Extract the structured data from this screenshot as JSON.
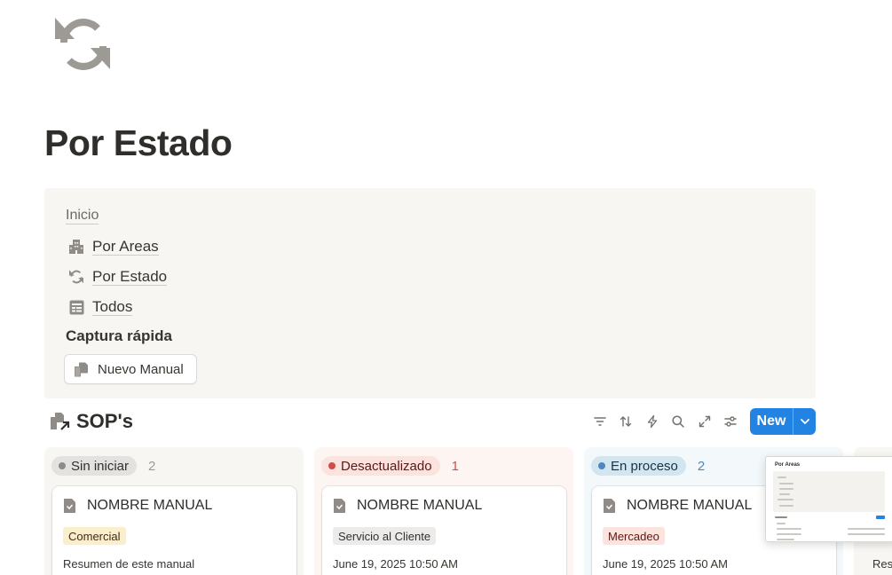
{
  "page": {
    "title": "Por Estado",
    "icon": "rotate-arrows-icon"
  },
  "callout": {
    "inicio_link": "Inicio",
    "nav": [
      {
        "label": "Por Areas",
        "icon": "building-icon"
      },
      {
        "label": "Por Estado",
        "icon": "rotate-arrows-icon"
      },
      {
        "label": "Todos",
        "icon": "table-icon"
      }
    ],
    "capture_label": "Captura rápida",
    "new_manual_label": "Nuevo Manual"
  },
  "database": {
    "title": "SOP's",
    "toolbar": [
      "filter-icon",
      "sort-icon",
      "automation-bolt-icon",
      "search-icon",
      "expand-icon",
      "settings-sliders-icon"
    ],
    "new_label": "New"
  },
  "board": {
    "columns": [
      {
        "status": "Sin iniciar",
        "count": "2",
        "card": {
          "title": "NOMBRE MANUAL",
          "tag": "Comercial",
          "subtitle": "Resumen de este manual"
        }
      },
      {
        "status": "Desactualizado",
        "count": "1",
        "card": {
          "title": "NOMBRE MANUAL",
          "tag": "Servicio al Cliente",
          "subtitle": "June 19, 2025 10:50 AM"
        }
      },
      {
        "status": "En proceso",
        "count": "2",
        "card": {
          "title": "NOMBRE MANUAL",
          "tag": "Mercadeo",
          "subtitle": "June 19, 2025 10:50 AM"
        }
      },
      {
        "partial_subtitle": "Res"
      }
    ]
  },
  "preview_thumbnail": {
    "title": "Por Areas"
  },
  "colors": {
    "accent": "#2383e2",
    "callout_bg": "#f7f6f3",
    "status_gray": "#8e8b86",
    "status_red": "#d44c47",
    "status_blue": "#4d88bc"
  }
}
